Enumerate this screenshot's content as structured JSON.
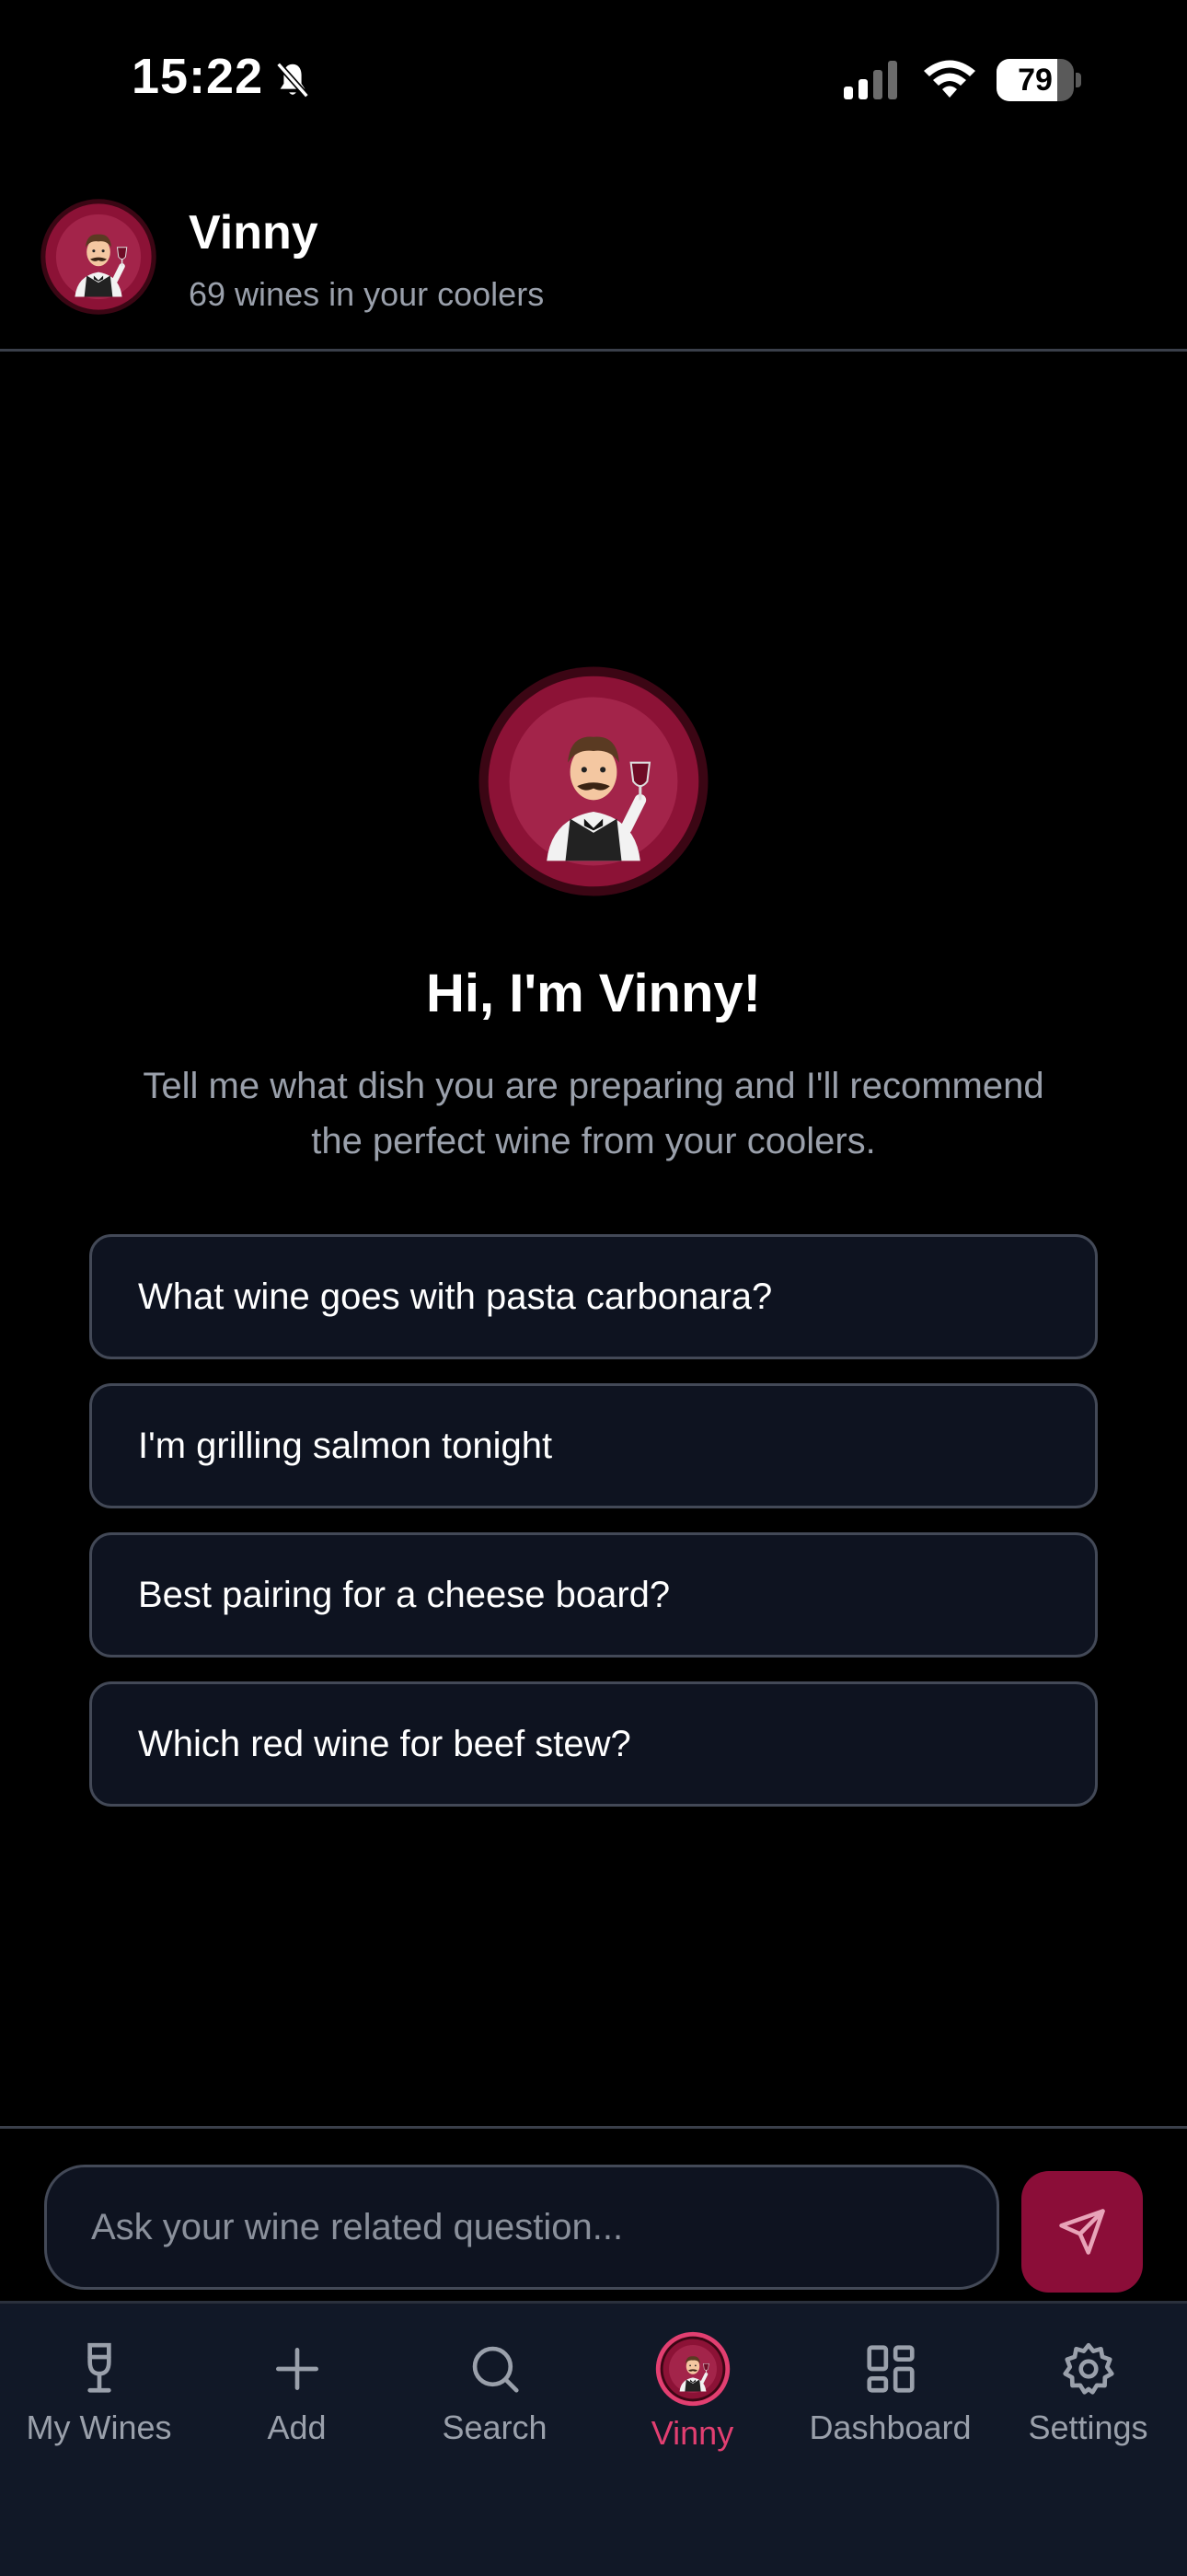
{
  "status_bar": {
    "time": "15:22",
    "battery": "79",
    "battery_level": 0.79
  },
  "header": {
    "name": "Vinny",
    "subtitle": "69 wines in your coolers"
  },
  "hero": {
    "title": "Hi, I'm Vinny!",
    "text": "Tell me what dish you are preparing and I'll recommend the perfect wine from your coolers."
  },
  "suggestions": [
    "What wine goes with pasta carbonara?",
    "I'm grilling salmon tonight",
    "Best pairing for a cheese board?",
    "Which red wine for beef stew?"
  ],
  "input": {
    "placeholder": "Ask your wine related question..."
  },
  "nav": {
    "items": [
      {
        "label": "My Wines",
        "icon": "wine-glass-icon"
      },
      {
        "label": "Add",
        "icon": "plus-icon"
      },
      {
        "label": "Search",
        "icon": "search-icon"
      },
      {
        "label": "Vinny",
        "icon": "vinny-avatar",
        "active": true
      },
      {
        "label": "Dashboard",
        "icon": "grid-icon"
      },
      {
        "label": "Settings",
        "icon": "gear-icon"
      }
    ]
  },
  "colors": {
    "accent": "#8b0d38",
    "active_nav": "#e23f71",
    "card_bg": "#0e1320",
    "nav_bg": "#111827"
  }
}
